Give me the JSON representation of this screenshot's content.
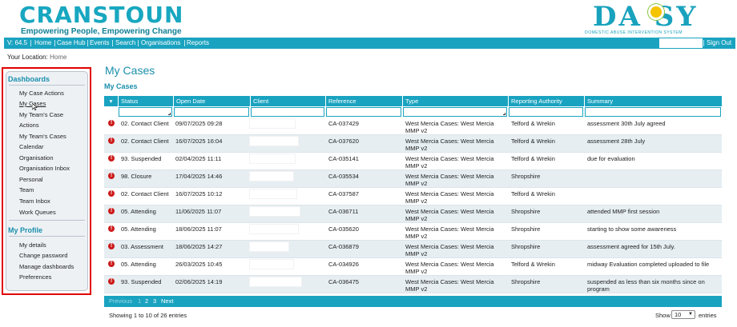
{
  "header": {
    "brand": "CRANSTOUN",
    "tagline": "Empowering People, Empowering Change",
    "product": "DA SY",
    "product_sub": "DOMESTIC ABUSE INTERVENTION SYSTEM"
  },
  "nav": {
    "version": "V: 64.5",
    "items": [
      "Home",
      "Case Hub",
      "Events",
      "Search",
      "Organisations",
      "Reports"
    ],
    "signout": "Sign Out"
  },
  "location": {
    "label": "Your Location:",
    "value": "Home"
  },
  "sidebar": {
    "dashboards_title": "Dashboards",
    "dashboards": [
      "My Case Actions",
      "My Cases",
      "My Team's Case",
      "Actions",
      "My Team's Cases",
      "Calendar",
      "Organisation",
      "Organisation Inbox",
      "Personal",
      "Team",
      "Team Inbox",
      "Work Queues"
    ],
    "profile_title": "My Profile",
    "profile": [
      "My details",
      "Change password",
      "Manage dashboards",
      "Preferences"
    ]
  },
  "page": {
    "title": "My Cases",
    "subtitle": "My Cases"
  },
  "table": {
    "headers": [
      "Status",
      "Open Date",
      "Client",
      "Reference",
      "Type",
      "Reporting Authority",
      "Summary"
    ],
    "rows": [
      {
        "status": "02. Contact Client",
        "open": "09/07/2025 09:28",
        "ref": "CA-037429",
        "type": "West Mercia Cases: West Mercia MMP v2",
        "auth": "Telford & Wrekin",
        "summary": "assessment 30th July agreed"
      },
      {
        "status": "02. Contact Client",
        "open": "16/07/2025 16:04",
        "ref": "CA-037620",
        "type": "West Mercia Cases: West Mercia MMP v2",
        "auth": "Telford & Wrekin",
        "summary": "assessment 28th July"
      },
      {
        "status": "93. Suspended",
        "open": "02/04/2025 11:11",
        "ref": "CA-035141",
        "type": "West Mercia Cases: West Mercia MMP v2",
        "auth": "Telford & Wrekin",
        "summary": "due for evaluation"
      },
      {
        "status": "98. Closure",
        "open": "17/04/2025 14:46",
        "ref": "CA-035534",
        "type": "West Mercia Cases: West Mercia MMP v2",
        "auth": "Shropshire",
        "summary": ""
      },
      {
        "status": "02. Contact Client",
        "open": "16/07/2025 10:12",
        "ref": "CA-037587",
        "type": "West Mercia Cases: West Mercia MMP v2",
        "auth": "Telford & Wrekin",
        "summary": ""
      },
      {
        "status": "05. Attending",
        "open": "11/06/2025 11:07",
        "ref": "CA-036711",
        "type": "West Mercia Cases: West Mercia MMP v2",
        "auth": "Shropshire",
        "summary": "attended MMP first session"
      },
      {
        "status": "05. Attending",
        "open": "18/06/2025 11:07",
        "ref": "CA-035620",
        "type": "West Mercia Cases: West Mercia MMP v2",
        "auth": "Shropshire",
        "summary": "starting to show some awareness"
      },
      {
        "status": "03. Assessment",
        "open": "18/06/2025 14:27",
        "ref": "CA-036879",
        "type": "West Mercia Cases: West Mercia MMP v2",
        "auth": "Shropshire",
        "summary": "assessment agreed for 15th July."
      },
      {
        "status": "05. Attending",
        "open": "26/03/2025 10:45",
        "ref": "CA-034926",
        "type": "West Mercia Cases: West Mercia MMP v2",
        "auth": "Telford & Wrekin",
        "summary": "midway Evaluation completed uploaded to file"
      },
      {
        "status": "93. Suspended",
        "open": "02/06/2025 14:19",
        "ref": "CA-036475",
        "type": "West Mercia Cases: West Mercia MMP v2",
        "auth": "Shropshire",
        "summary": "suspended as less than six months since on program"
      }
    ]
  },
  "pager": {
    "previous": "Previous",
    "pages": [
      "1",
      "2",
      "3"
    ],
    "next": "Next"
  },
  "footer": {
    "info": "Showing 1 to 10 of 26 entries",
    "show": "Show",
    "page_size": "10",
    "entries": "entries"
  },
  "colors": {
    "accent": "#1aa3c0",
    "warning": "#cc1a1a",
    "highlight": "#e00000"
  }
}
